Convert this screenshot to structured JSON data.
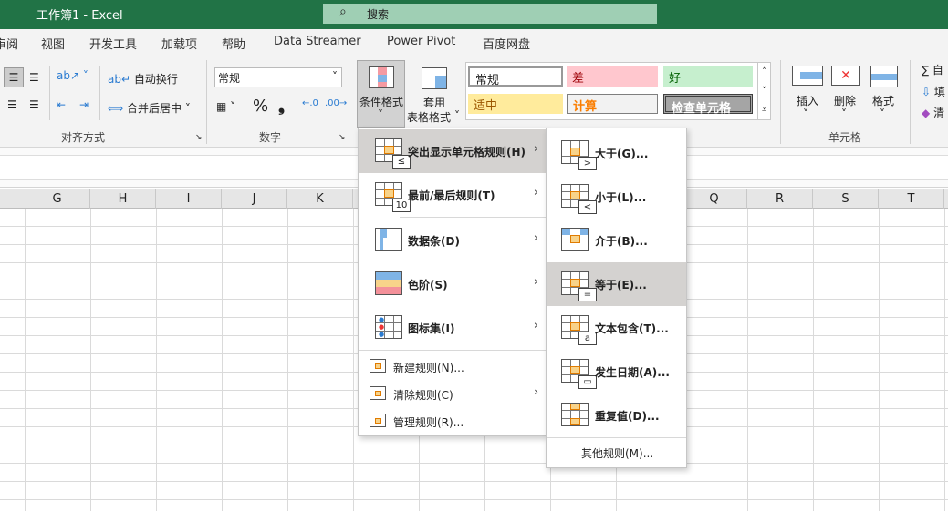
{
  "window": {
    "title": "工作簿1  -  Excel",
    "search_placeholder": "搜索"
  },
  "tabs": [
    "审阅",
    "视图",
    "开发工具",
    "加载项",
    "帮助",
    "Data Streamer",
    "Power Pivot",
    "百度网盘"
  ],
  "ribbon": {
    "alignment": {
      "wrap": "自动换行",
      "merge": "合并后居中",
      "label": "对齐方式"
    },
    "number": {
      "format": "常规",
      "percent": "%",
      "comma": "❟",
      "label": "数字"
    },
    "styles": {
      "cond_format": "条件格式",
      "table_format": [
        "套用",
        "表格格式"
      ],
      "cells": [
        {
          "text": "常规",
          "bg": "#ffffff",
          "fg": "#000000"
        },
        {
          "text": "差",
          "bg": "#ffc7ce",
          "fg": "#9c0006"
        },
        {
          "text": "好",
          "bg": "#c6efce",
          "fg": "#006100"
        },
        {
          "text": "适中",
          "bg": "#ffeb9c",
          "fg": "#9c5700"
        },
        {
          "text": "计算",
          "bg": "#f2f2f2",
          "fg": "#fa7d00"
        },
        {
          "text": "检查单元格",
          "bg": "#a5a5a5",
          "fg": "#ffffff"
        }
      ]
    },
    "cells": {
      "insert": "插入",
      "delete": "删除",
      "format": "格式",
      "label": "单元格"
    },
    "editing": {
      "sum": "自",
      "fill": "填",
      "clear": "清"
    }
  },
  "columns": [
    "G",
    "H",
    "I",
    "J",
    "K",
    "L",
    "M",
    "N",
    "O",
    "P",
    "Q",
    "R",
    "S",
    "T"
  ],
  "menu": {
    "items": [
      {
        "label": "突出显示单元格规则(H)",
        "icon": "highlight-rules-icon",
        "ov": "≤"
      },
      {
        "label": "最前/最后规则(T)",
        "icon": "top-bottom-icon",
        "ov": "10"
      },
      {
        "label": "数据条(D)",
        "icon": "data-bars-icon"
      },
      {
        "label": "色阶(S)",
        "icon": "color-scales-icon"
      },
      {
        "label": "图标集(I)",
        "icon": "icon-sets-icon"
      }
    ],
    "small": [
      {
        "label": "新建规则(N)..."
      },
      {
        "label": "清除规则(C)"
      },
      {
        "label": "管理规则(R)..."
      }
    ]
  },
  "submenu": {
    "items": [
      {
        "label": "大于(G)...",
        "ov": ">"
      },
      {
        "label": "小于(L)...",
        "ov": "<"
      },
      {
        "label": "介于(B)...",
        "ov": ""
      },
      {
        "label": "等于(E)...",
        "ov": "="
      },
      {
        "label": "文本包含(T)...",
        "ov": "a"
      },
      {
        "label": "发生日期(A)...",
        "ov": "▭"
      },
      {
        "label": "重复值(D)...",
        "ov": ""
      }
    ],
    "more": "其他规则(M)..."
  }
}
